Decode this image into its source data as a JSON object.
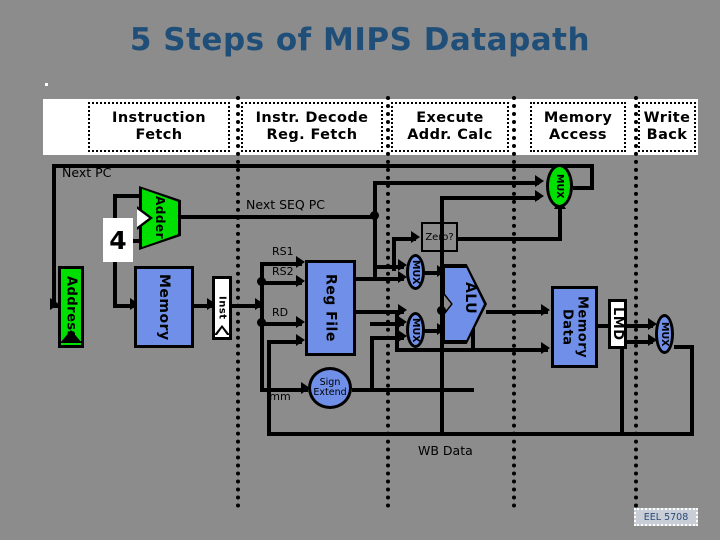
{
  "slide": {
    "title": "5 Steps of MIPS Datapath",
    "footer": "EEL 5708",
    "background_color": "#8c8c8c",
    "title_color": "#1f4e79"
  },
  "stages": [
    {
      "line1": "Instruction",
      "line2": "Fetch"
    },
    {
      "line1": "Instr. Decode",
      "line2": "Reg. Fetch"
    },
    {
      "line1": "Execute",
      "line2": "Addr. Calc"
    },
    {
      "line1": "Memory",
      "line2": "Access"
    },
    {
      "line1": "Write",
      "line2": "Back"
    }
  ],
  "labels": {
    "next_pc": "Next PC",
    "next_seq_pc": "Next SEQ PC",
    "four": "4",
    "rs1": "RS1",
    "rs2": "RS2",
    "rd": "RD",
    "imm": "Imm",
    "zero": "Zero?",
    "wb_data": "WB Data"
  },
  "blocks": {
    "address": "Address",
    "adder": "Adder",
    "memory": "Memory",
    "inst": "Inst",
    "reg_file": "Reg File",
    "sign_extend_l1": "Sign",
    "sign_extend_l2": "Extend",
    "alu": "ALU",
    "data_memory_l1": "Data",
    "data_memory_l2": "Memory",
    "lmd": "LMD",
    "mux": "MUX"
  },
  "colors": {
    "green_block": "#00e000",
    "blue_block": "#6f8fe8",
    "white_block": "#ffffff",
    "wire": "#000000"
  }
}
